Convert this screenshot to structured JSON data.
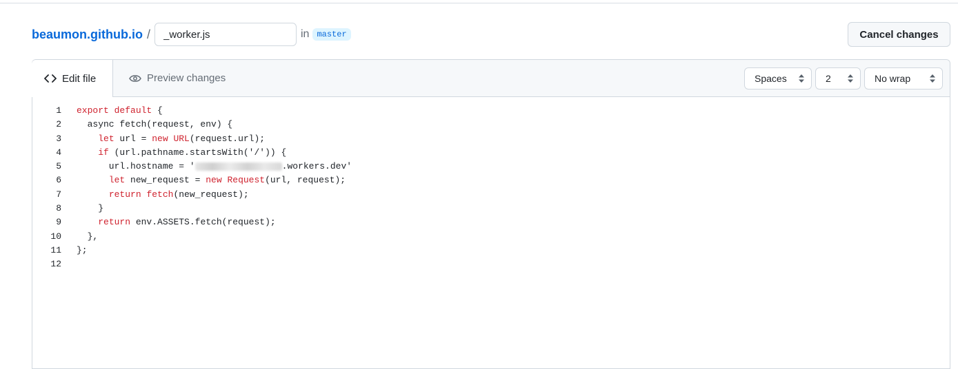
{
  "header": {
    "repo": "beaumon.github.io",
    "separator": "/",
    "filename": "_worker.js",
    "in_label": "in",
    "branch": "master",
    "cancel_label": "Cancel changes"
  },
  "tabs": {
    "edit_label": "Edit file",
    "preview_label": "Preview changes"
  },
  "options": {
    "indent_mode": "Spaces",
    "indent_size": "2",
    "wrap_mode": "No wrap"
  },
  "code": {
    "line_numbers": [
      "1",
      "2",
      "3",
      "4",
      "5",
      "6",
      "7",
      "8",
      "9",
      "10",
      "11",
      "12"
    ],
    "lines": [
      [
        {
          "t": "export default",
          "c": "kw"
        },
        {
          "t": " {",
          "c": ""
        }
      ],
      [
        {
          "t": "  async fetch(request, env) {",
          "c": ""
        }
      ],
      [
        {
          "t": "    ",
          "c": ""
        },
        {
          "t": "let",
          "c": "kw"
        },
        {
          "t": " url = ",
          "c": ""
        },
        {
          "t": "new",
          "c": "kw"
        },
        {
          "t": " ",
          "c": ""
        },
        {
          "t": "URL",
          "c": "kw"
        },
        {
          "t": "(request.url);",
          "c": ""
        }
      ],
      [
        {
          "t": "    ",
          "c": ""
        },
        {
          "t": "if",
          "c": "kw"
        },
        {
          "t": " (url.pathname.startsWith('/')) {",
          "c": ""
        }
      ],
      [
        {
          "t": "      url.hostname = '",
          "c": ""
        },
        {
          "t": "",
          "c": "blur"
        },
        {
          "t": ".workers.dev'",
          "c": ""
        }
      ],
      [
        {
          "t": "      ",
          "c": ""
        },
        {
          "t": "let",
          "c": "kw"
        },
        {
          "t": " new_request = ",
          "c": ""
        },
        {
          "t": "new",
          "c": "kw"
        },
        {
          "t": " ",
          "c": ""
        },
        {
          "t": "Request",
          "c": "kw"
        },
        {
          "t": "(url, request);",
          "c": ""
        }
      ],
      [
        {
          "t": "      ",
          "c": ""
        },
        {
          "t": "return",
          "c": "kw"
        },
        {
          "t": " ",
          "c": ""
        },
        {
          "t": "fetch",
          "c": "kw"
        },
        {
          "t": "(new_request);",
          "c": ""
        }
      ],
      [
        {
          "t": "    }",
          "c": ""
        }
      ],
      [
        {
          "t": "    ",
          "c": ""
        },
        {
          "t": "return",
          "c": "kw"
        },
        {
          "t": " env.ASSETS.fetch(request);",
          "c": ""
        }
      ],
      [
        {
          "t": "  },",
          "c": ""
        }
      ],
      [
        {
          "t": "};",
          "c": ""
        }
      ],
      [
        {
          "t": "",
          "c": ""
        }
      ]
    ]
  },
  "colors": {
    "link": "#0969da",
    "keyword": "#cf222e",
    "border": "#d0d7de",
    "tabbar_bg": "#f6f8fa"
  },
  "icons": {
    "edit_tab": "code-icon",
    "preview_tab": "eye-icon",
    "select": "select-arrows-icon"
  }
}
